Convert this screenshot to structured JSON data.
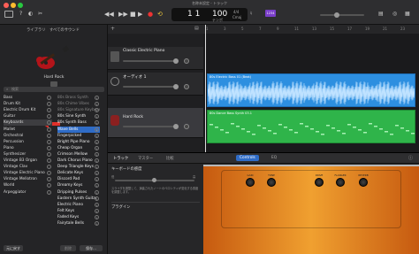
{
  "window": {
    "title": "名称未設定 - トラック"
  },
  "transport": {
    "position": "1 1",
    "tempo": "100",
    "tempo_label": "テンポ",
    "time_sig": "4/4",
    "key": "Cmaj",
    "counter": "1234"
  },
  "library": {
    "tab_library": "ライブラリ",
    "tab_all": "すべてのサウンド",
    "title": "Hard Rock",
    "search_placeholder": "検索",
    "categories": [
      "Bass",
      "Drum Kit",
      "Electric Drum Kit",
      "Guitar",
      "Keyboards",
      "Mallet",
      "Orchestral",
      "Percussion",
      "Piano",
      "Synthesizer",
      "Vintage B3 Organ",
      "Vintage Clav",
      "Vintage Electric Piano",
      "Vintage Mellotron",
      "World",
      "Arpeggiator"
    ],
    "patches": [
      "80s Brass Synth",
      "80s Chime Vibes",
      "80s Signature Keyboard",
      "80s Sine Synth",
      "80s Synth Bass",
      "Wave Bells",
      "Fingerpicked",
      "Bright Pipe Piano",
      "Cheap Organ",
      "Crimson Mellow",
      "Dark Chorus Piano",
      "Deep Triangle Keys",
      "Delicate Keys",
      "Discord Pad",
      "Dreamy Keys",
      "Dripping Pulses",
      "Eastern Synth Guitar",
      "Electric Piano",
      "Felt Keys",
      "Faded Keys",
      "Fairytale Bells"
    ],
    "bottom_btn": "元に戻す",
    "delete_btn": "削除",
    "save_btn": "保存..."
  },
  "tracks": [
    {
      "name": "Classic Electric Piano"
    },
    {
      "name": "オーディオ 1"
    },
    {
      "name": "Hard Rock"
    }
  ],
  "regions": [
    {
      "label": "80s Electric Bass 01 (Beat)"
    },
    {
      "label": "80s Dance Bass Synth 03.1"
    }
  ],
  "ruler": [
    "1",
    "3",
    "5",
    "7",
    "9",
    "11",
    "13",
    "15",
    "17",
    "19",
    "21",
    "23"
  ],
  "bottom": {
    "tab_track": "トラック",
    "tab_master": "マスター",
    "tab_compare": "比較",
    "controls": "Controls",
    "eq": "EQ",
    "keyboard_section": "キーボードの感度",
    "sens_text": "スライダを調整して、演奏されたノートのベロシティが変化する感度を調整します。",
    "plugins": "プラグイン",
    "low": "低",
    "high": "高",
    "amp_labels": [
      "GAIN",
      "TONE",
      "DRIVE",
      "FLANGER",
      "REVERB"
    ]
  },
  "colors": {
    "accent": "#2f6cc7",
    "audio": "#2d8fe0",
    "midi": "#2fb44a"
  }
}
